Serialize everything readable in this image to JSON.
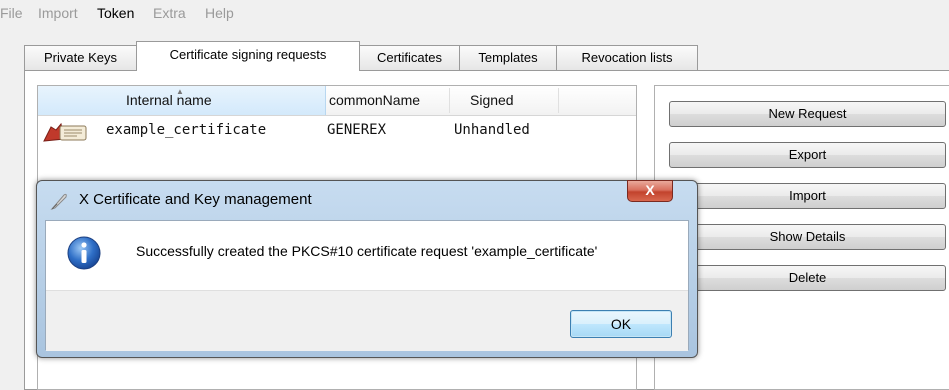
{
  "menu": [
    "File",
    "Import",
    "Token",
    "Extra",
    "Help"
  ],
  "tabs": [
    "Private Keys",
    "Certificate signing requests",
    "Certificates",
    "Templates",
    "Revocation lists"
  ],
  "selected_tab": "Certificate signing requests",
  "table": {
    "columns": [
      "Internal name",
      "commonName",
      "Signed"
    ],
    "rows": [
      {
        "icon": "certificate-request-icon",
        "internal_name": "example_certificate",
        "common_name": "GENEREX",
        "signed": "Unhandled"
      }
    ]
  },
  "buttons": [
    "New Request",
    "Export",
    "Import",
    "Show Details",
    "Delete"
  ],
  "dialog": {
    "title": "X Certificate and Key management",
    "message": "Successfully created the PKCS#10 certificate request 'example_certificate'",
    "ok_label": "OK",
    "close_label": "X",
    "icon": "info-icon"
  }
}
